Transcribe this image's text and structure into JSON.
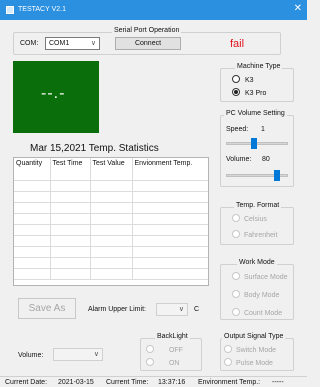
{
  "window": {
    "title": "TESTACY  V2.1",
    "close_glyph": "✕"
  },
  "serial": {
    "group_title": "Serial Port Operation",
    "com_label": "COM:",
    "com_value": "COM1",
    "connect_label": "Connect",
    "status": "fail",
    "status_color": "#e0141e"
  },
  "display": {
    "value": "--.-",
    "bg_color": "#0a6e0a"
  },
  "machine_type": {
    "title": "Machine Type",
    "options": [
      "K3",
      "K3  Pro"
    ],
    "selected": "K3  Pro"
  },
  "stats": {
    "title": "Mar 15,2021 Temp. Statistics",
    "columns": [
      "Quantity",
      "Test Time",
      "Test Value",
      "Envionment Temp."
    ]
  },
  "pc_volume": {
    "title": "PC Volume Setting",
    "speed_label": "Speed:",
    "speed_value": "1",
    "volume_label": "Volume:",
    "volume_value": "80",
    "speed_level_fraction": 0.45,
    "volume_level_fraction": 0.85
  },
  "temp_format": {
    "title": "Temp. Format",
    "options": [
      "Celsius",
      "Fahrenheit"
    ]
  },
  "work_mode": {
    "title": "Work Mode",
    "options": [
      "Surface Mode",
      "Body Mode",
      "Count Mode"
    ]
  },
  "save": {
    "label": "Save As"
  },
  "alarm": {
    "label": "Alarm Upper Limit:",
    "unit": "C"
  },
  "backlight": {
    "title": "BackLight",
    "options": [
      "OFF",
      "ON"
    ]
  },
  "output_signal": {
    "title": "Output Signal Type",
    "options": [
      "Switch Mode",
      "Pulse Mode"
    ]
  },
  "volume_combo": {
    "label": "Volume:"
  },
  "statusbar": {
    "current_date_label": "Current Date:",
    "current_date": "2021-03-15",
    "current_time_label": "Current Time:",
    "current_time": "13:37:16",
    "env_temp_label": "Environment Temp.:",
    "env_temp": "-----"
  }
}
